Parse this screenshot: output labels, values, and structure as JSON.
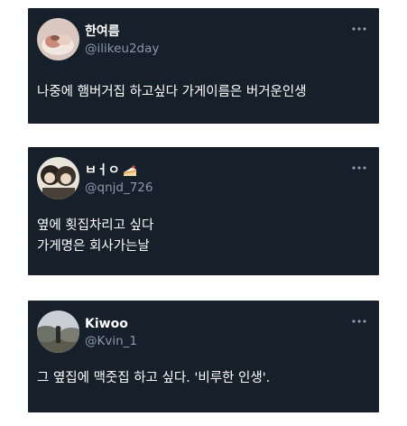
{
  "tweets": [
    {
      "display_name": "한여름",
      "handle": "@ilikeu2day",
      "lines": [
        "나중에 햄버거집 하고싶다 가게이름은 버거운인생"
      ],
      "avatar_icon": "profile-photo",
      "more_icon": "more-options-icon"
    },
    {
      "display_name": "ㅂㅓㅇ",
      "handle": "@qnjd_726",
      "lines": [
        "옆에 횟집차리고 싶다",
        "가게명은 회사가는날"
      ],
      "avatar_icon": "profile-photo",
      "badge_icon": "cake-icon",
      "more_icon": "more-options-icon"
    },
    {
      "display_name": "Kiwoo",
      "handle": "@Kvin_1",
      "lines": [
        "그 옆집에 맥줏집 하고 싶다. '비루한 인생'."
      ],
      "avatar_icon": "profile-photo",
      "more_icon": "more-options-icon"
    }
  ],
  "colors": {
    "card_background": "#15202b",
    "handle_gray": "#8b98a5",
    "text": "#ffffff",
    "page_background": "#ffffff"
  }
}
